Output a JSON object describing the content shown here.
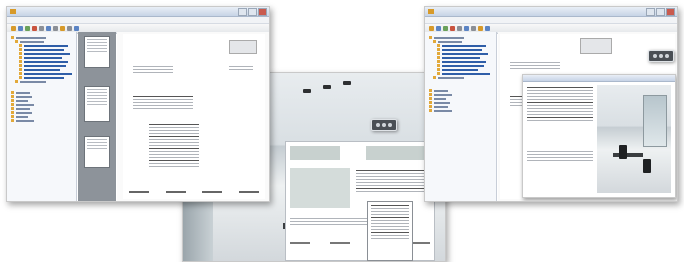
{
  "screens": [
    {
      "id": "left",
      "window_title": "",
      "menu": [
        "",
        "",
        "",
        "",
        ""
      ]
    },
    {
      "id": "middle",
      "window_title": "",
      "menu": []
    },
    {
      "id": "right",
      "window_title": "",
      "menu": [
        "",
        "",
        "",
        "",
        ""
      ]
    }
  ],
  "colors": {
    "folder": "#e2a93a",
    "tree_selected": "#2f5ea8",
    "thumb_strip": "#8d939a",
    "titlebar": "#c6d3e6"
  },
  "icons": [
    "app-icon",
    "folder-icon",
    "toolbar-icon",
    "close-icon",
    "minimize-icon",
    "maximize-icon",
    "lamp-icon"
  ]
}
